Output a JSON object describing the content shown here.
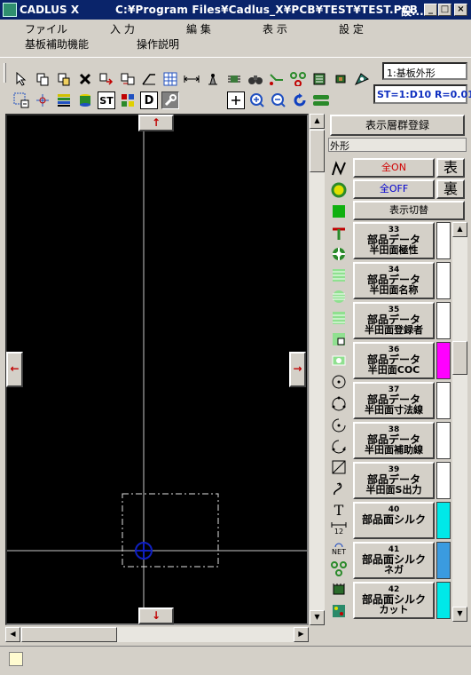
{
  "window": {
    "app_name": "CADLUS X",
    "path": "C:¥Program Files¥Cadlus_X¥PCB¥TEST¥TEST.PCB",
    "title_suffix": "設...",
    "minimize": "_",
    "maximize": "□",
    "close": "×"
  },
  "menu": {
    "file": "ファイル",
    "input": "入 力",
    "edit": "編 集",
    "view": "表 示",
    "settings": "設 定",
    "board_assist": "基板補助機能",
    "help": "操作説明"
  },
  "toolbar": {
    "layer_combo": "1:基板外形",
    "st_readout": "ST=1:D10 R=0.01",
    "st_label": "ST",
    "d_label": "D"
  },
  "canvas": {
    "arrow_up": "↑",
    "arrow_down": "↓",
    "arrow_left": "←",
    "arrow_right": "→"
  },
  "panel": {
    "register_button": "表示層群登録",
    "group_label": "外形",
    "all_on": "全ON",
    "all_off": "全OFF",
    "front": "表",
    "back": "裏",
    "toggle": "表示切替",
    "text_icon": "T",
    "dim_icon_label": "12",
    "net_label": "NET",
    "layers": [
      {
        "num": "33",
        "line1": "部品データ",
        "line2": "半田面極性",
        "color": "#ffffff"
      },
      {
        "num": "34",
        "line1": "部品データ",
        "line2": "半田面名称",
        "color": "#ffffff"
      },
      {
        "num": "35",
        "line1": "部品データ",
        "line2": "半田面登録者",
        "color": "#ffffff"
      },
      {
        "num": "36",
        "line1": "部品データ",
        "line2": "半田面COC",
        "color": "#ff00ff"
      },
      {
        "num": "37",
        "line1": "部品データ",
        "line2": "半田面寸法線",
        "color": "#ffffff"
      },
      {
        "num": "38",
        "line1": "部品データ",
        "line2": "半田面補助線",
        "color": "#ffffff"
      },
      {
        "num": "39",
        "line1": "部品データ",
        "line2": "半田面S出力",
        "color": "#ffffff"
      },
      {
        "num": "40",
        "line1": "部品面シルク",
        "line2": "",
        "color": "#00e8e8"
      },
      {
        "num": "41",
        "line1": "部品面シルク",
        "line2": "ネガ",
        "color": "#3a9be0"
      },
      {
        "num": "42",
        "line1": "部品面シルク",
        "line2": "カット",
        "color": "#00e8e8"
      }
    ]
  },
  "colors": {
    "title_bg": "#0a246a",
    "canvas_bg": "#000000",
    "all_on_text": "#d00000",
    "all_off_text": "#0000d0"
  }
}
